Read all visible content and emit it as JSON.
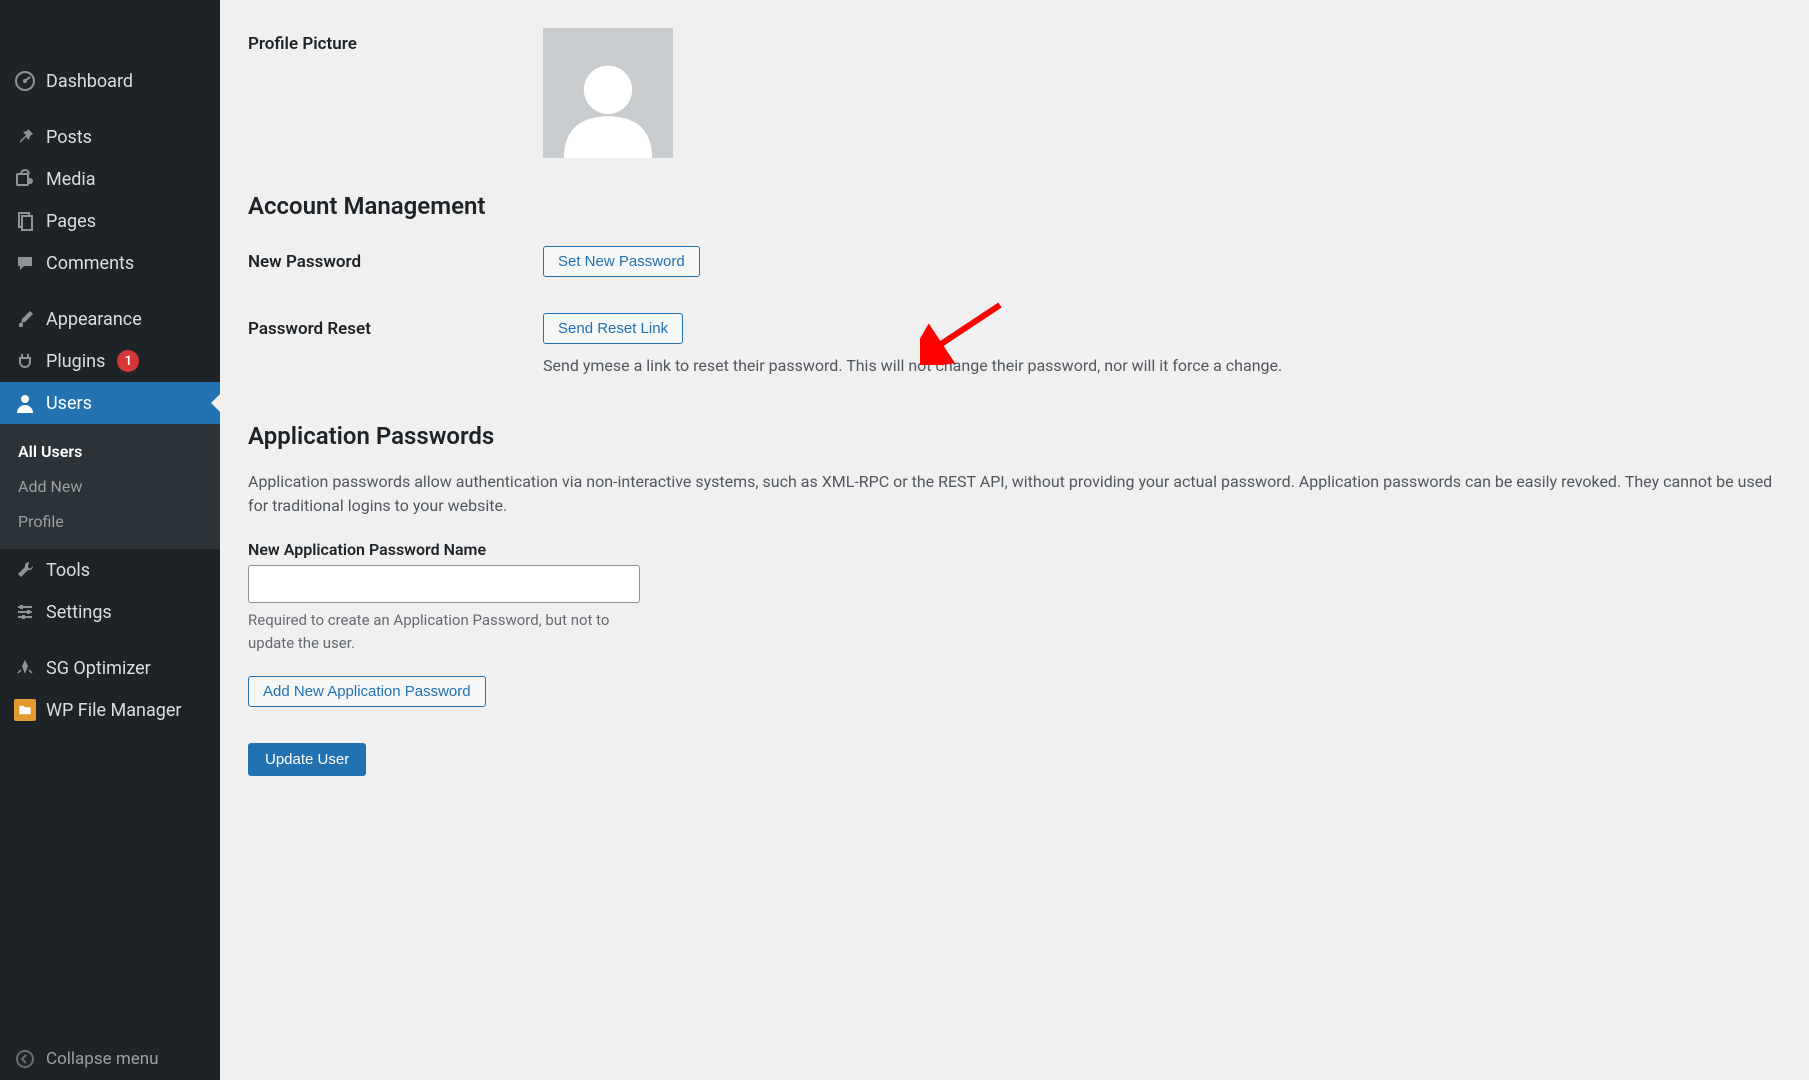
{
  "sidebar": {
    "items": [
      {
        "label": "Dashboard",
        "icon": "dashboard"
      },
      {
        "label": "Posts",
        "icon": "pin"
      },
      {
        "label": "Media",
        "icon": "media"
      },
      {
        "label": "Pages",
        "icon": "pages"
      },
      {
        "label": "Comments",
        "icon": "comments"
      },
      {
        "label": "Appearance",
        "icon": "brush"
      },
      {
        "label": "Plugins",
        "icon": "plug",
        "badge": "1"
      },
      {
        "label": "Users",
        "icon": "person",
        "active": true
      },
      {
        "label": "Tools",
        "icon": "wrench"
      },
      {
        "label": "Settings",
        "icon": "sliders"
      },
      {
        "label": "SG Optimizer",
        "icon": "rocket"
      },
      {
        "label": "WP File Manager",
        "icon": "folder"
      }
    ],
    "submenu": {
      "items": [
        {
          "label": "All Users",
          "current": true
        },
        {
          "label": "Add New"
        },
        {
          "label": "Profile"
        }
      ]
    },
    "collapse": "Collapse menu"
  },
  "profile_picture_label": "Profile Picture",
  "account_management_heading": "Account Management",
  "new_password_label": "New Password",
  "set_new_password_btn": "Set New Password",
  "password_reset_label": "Password Reset",
  "send_reset_link_btn": "Send Reset Link",
  "reset_description": "Send ymese a link to reset their password. This will not change their password, nor will it force a change.",
  "app_passwords_heading": "Application Passwords",
  "app_passwords_intro": "Application passwords allow authentication via non-interactive systems, such as XML-RPC or the REST API, without providing your actual password. Application passwords can be easily revoked. They cannot be used for traditional logins to your website.",
  "new_app_pw_name_label": "New Application Password Name",
  "new_app_pw_name_value": "",
  "app_pw_help": "Required to create an Application Password, but not to update the user.",
  "add_app_pw_btn": "Add New Application Password",
  "update_user_btn": "Update User"
}
